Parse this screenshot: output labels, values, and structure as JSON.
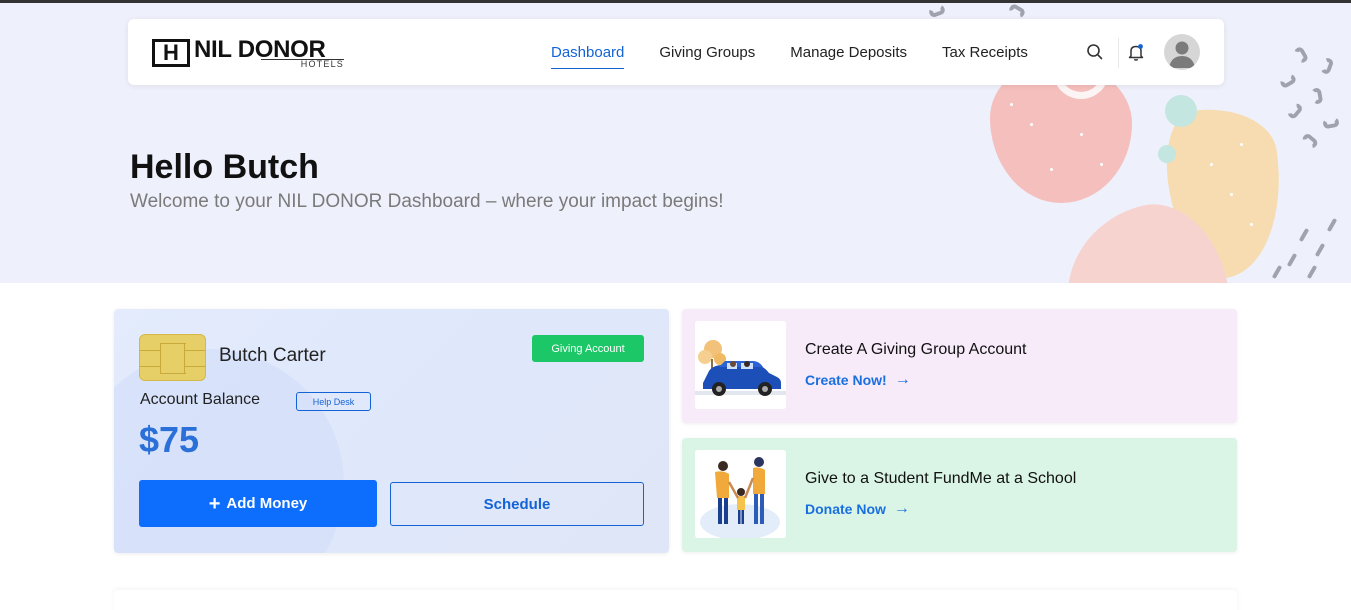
{
  "brand": {
    "logo_letter": "H",
    "logo_name": "NIL DONOR",
    "logo_sub": "HOTELS"
  },
  "nav": {
    "items": [
      {
        "label": "Dashboard",
        "active": true
      },
      {
        "label": "Giving Groups",
        "active": false
      },
      {
        "label": "Manage Deposits",
        "active": false
      },
      {
        "label": "Tax Receipts",
        "active": false
      }
    ],
    "icons": [
      "search-icon",
      "bell-icon",
      "avatar"
    ]
  },
  "greeting": {
    "title": "Hello Butch",
    "subtitle": "Welcome to your NIL DONOR Dashboard – where your impact begins!"
  },
  "account": {
    "name": "Butch Carter",
    "badge": "Giving Account",
    "balance_label": "Account Balance",
    "help_label": "Help Desk",
    "balance": "$75",
    "add_money_label": "Add Money",
    "schedule_label": "Schedule"
  },
  "promos": [
    {
      "title": "Create A Giving Group Account",
      "link": "Create Now!",
      "image": "car-family-illustration"
    },
    {
      "title": "Give to a Student FundMe at a School",
      "link": "Donate Now",
      "image": "family-illustration"
    }
  ],
  "colors": {
    "accent": "#0d6efd",
    "badge_green": "#1bc766",
    "hero_bg": "#eef0fb",
    "promo1_bg": "#f7ebfa",
    "promo2_bg": "#daf5e5"
  }
}
